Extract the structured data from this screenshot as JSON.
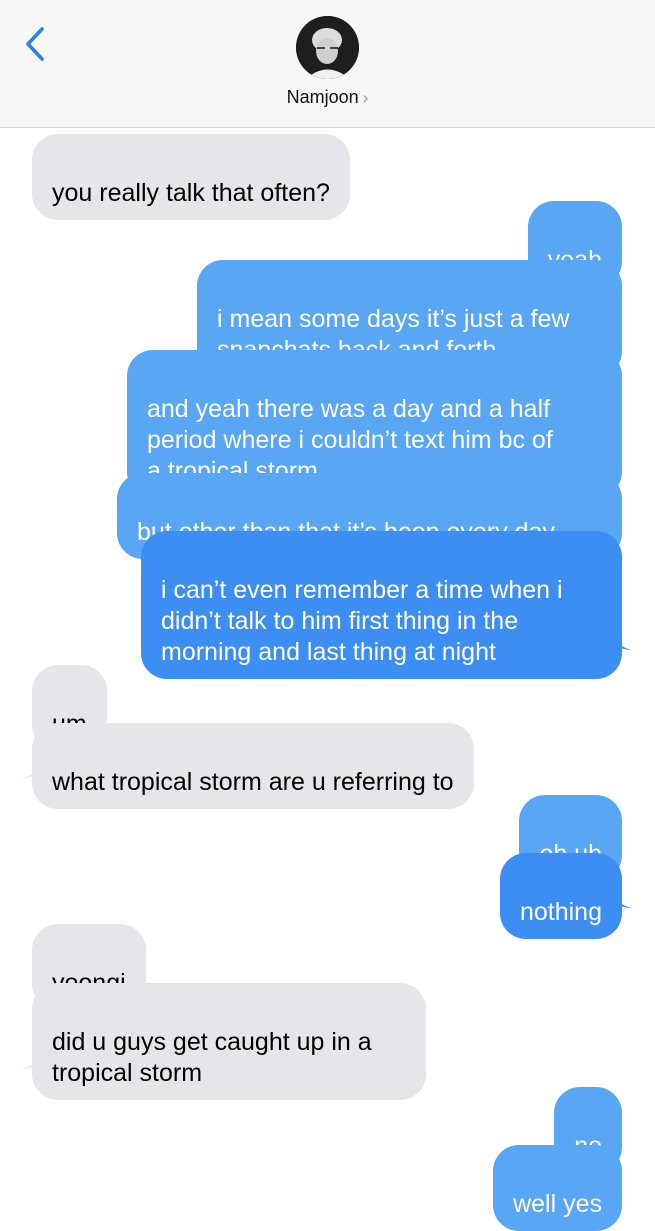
{
  "header": {
    "contact_name": "Namjoon",
    "chevron": "›",
    "back_icon": "chevron-left-icon",
    "accent_color": "#2f80ed"
  },
  "messages": [
    {
      "from": "them",
      "text": "you really talk that often?"
    },
    {
      "from": "me",
      "text": "yeah"
    },
    {
      "from": "me",
      "text": "i mean some days it’s just a few\nsnapchats back and forth"
    },
    {
      "from": "me",
      "text": "and yeah there was a day and a half\nperiod where i couldn’t text him bc of\na tropical storm"
    },
    {
      "from": "me",
      "text": "but other than that it’s been every day"
    },
    {
      "from": "me",
      "text": "i can’t even remember a time when i\ndidn’t talk to him first thing in the\nmorning and last thing at night"
    },
    {
      "from": "them",
      "text": "um"
    },
    {
      "from": "them",
      "text": "what tropical storm are u referring to"
    },
    {
      "from": "me",
      "text": "oh uh"
    },
    {
      "from": "me",
      "text": "nothing"
    },
    {
      "from": "them",
      "text": "yoongi"
    },
    {
      "from": "them",
      "text": "did u guys get caught up in a\ntropical storm"
    },
    {
      "from": "me",
      "text": "no"
    },
    {
      "from": "me",
      "text": "well yes"
    }
  ],
  "colors": {
    "incoming_bubble": "#e6e5ea",
    "outgoing_bubble_light": "#58a6f4",
    "outgoing_bubble_dark": "#3d8ef3"
  }
}
